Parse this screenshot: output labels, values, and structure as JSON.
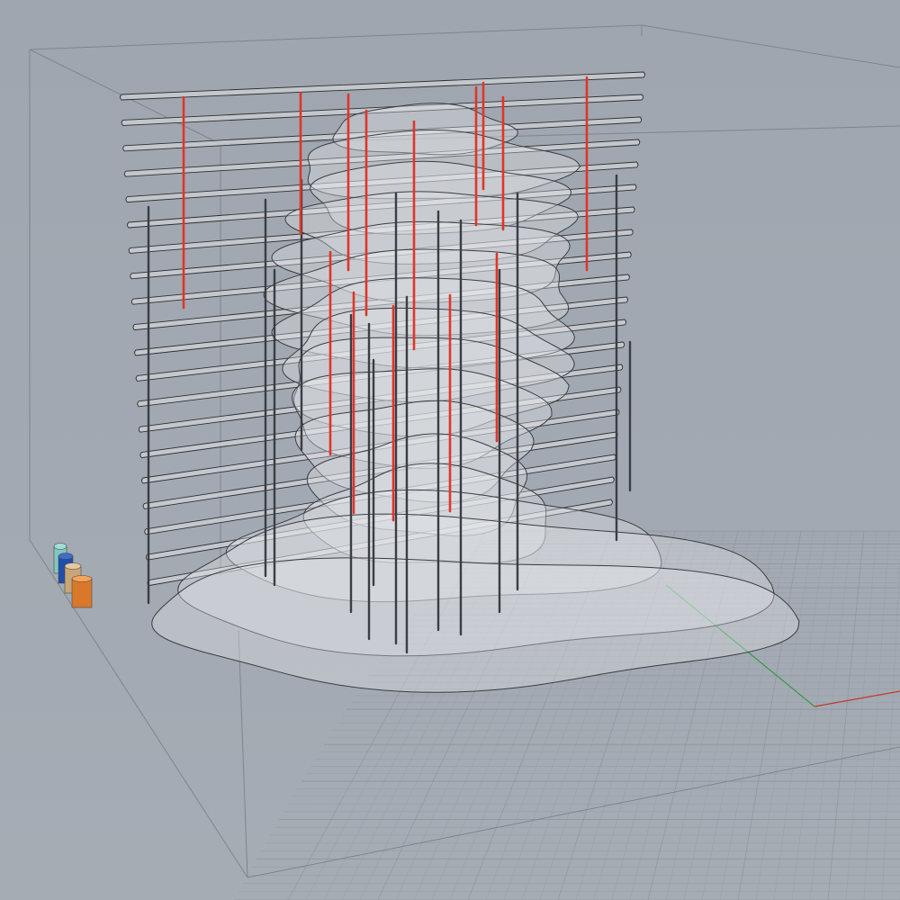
{
  "viewport": {
    "background_color": "#a1a7b0",
    "grid_color": "#8f959e",
    "grid_major_color": "#868c95",
    "bounding_box_color": "#7f858e",
    "x_axis_color": "#c0392b",
    "y_axis_color": "#2e9b45"
  },
  "model": {
    "slab_count": 20,
    "slab_fill": "#cfd2d6",
    "slab_edge": "#2c2f33",
    "contour_fill": "#e6e7ea",
    "contour_edge": "#3a3d42",
    "column_color_dark": "#3a3d42",
    "column_color_red": "#e0352b",
    "icons": [
      "cylinder-teal-icon",
      "cylinder-blue-icon",
      "cylinder-tan-icon",
      "cylinder-orange-icon"
    ]
  }
}
